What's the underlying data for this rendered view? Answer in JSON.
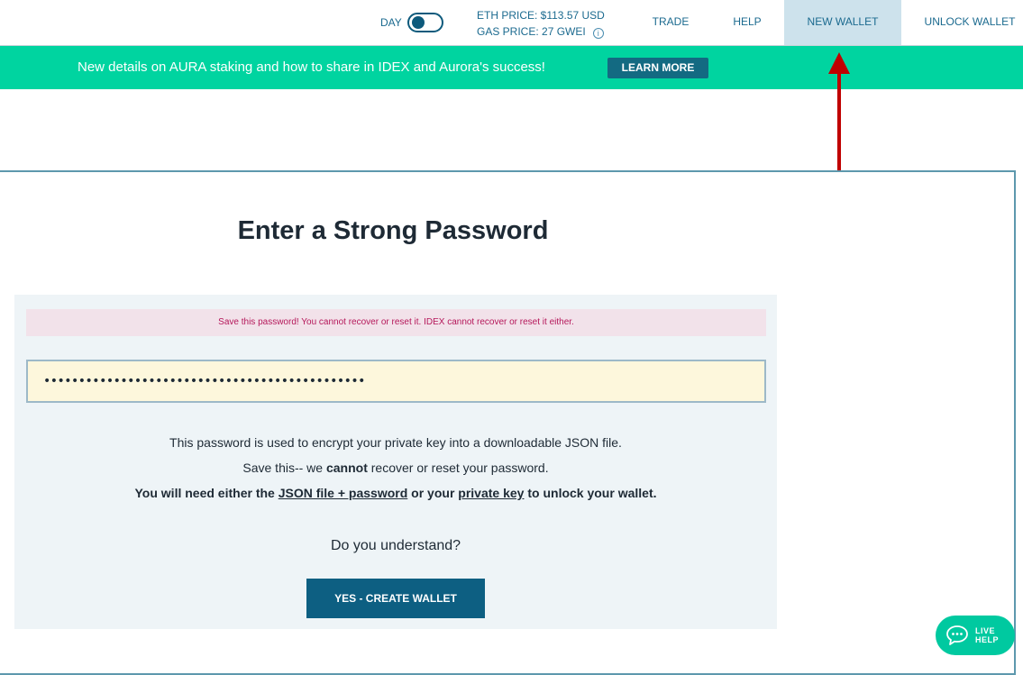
{
  "nav": {
    "day_label": "DAY",
    "eth_price": "ETH PRICE: $113.57 USD",
    "gas_price": "GAS PRICE: 27 GWEI",
    "links": {
      "trade": "TRADE",
      "help": "HELP",
      "new_wallet": "NEW WALLET",
      "unlock_wallet": "UNLOCK WALLET"
    }
  },
  "banner": {
    "text": "New details on AURA staking and how to share in IDEX and Aurora's success!",
    "button": "LEARN MORE"
  },
  "main": {
    "title": "Enter a Strong Password",
    "warning": "Save this password! You cannot recover or reset it. IDEX cannot recover or reset it either.",
    "password_value": "••••••••••••••••••••••••••••••••••••••••••••••",
    "info": {
      "line1": "This password is used to encrypt your private key into a downloadable JSON file.",
      "line2_pre": "Save this-- we ",
      "line2_bold": "cannot",
      "line2_post": " recover or reset your password.",
      "line3_pre": "You will need either the ",
      "line3_link1": "JSON file + password",
      "line3_mid": " or your ",
      "line3_link2": "private key",
      "line3_post": " to unlock your wallet."
    },
    "question": "Do you understand?",
    "button": "YES - CREATE WALLET"
  },
  "live_help": {
    "line1": "LIVE",
    "line2": "HELP"
  },
  "colors": {
    "accent_green": "#00d4a0",
    "primary_blue": "#0d5f82",
    "warning_red": "#b5175a",
    "annotation_arrow": "#c00000"
  }
}
